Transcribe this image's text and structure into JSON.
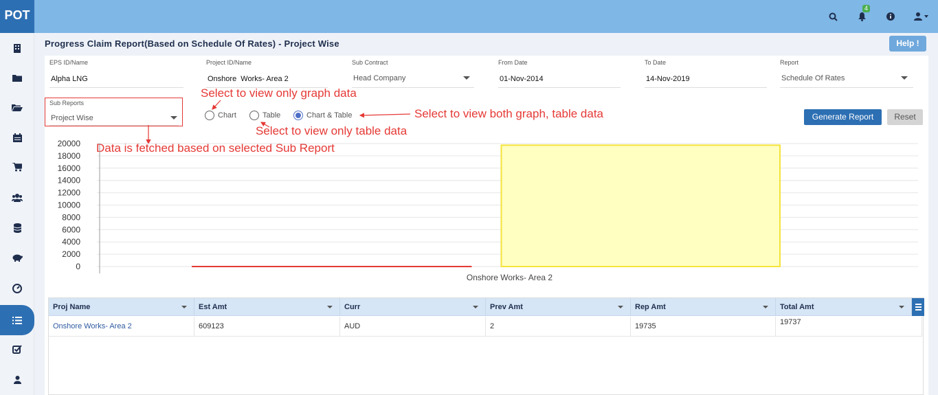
{
  "app": {
    "logo": "POT"
  },
  "topbar": {
    "notification_count": "4",
    "icons": [
      "search-icon",
      "bell-icon",
      "info-icon",
      "user-icon"
    ]
  },
  "sidebar": {
    "items": [
      "building-icon",
      "folder-icon",
      "folder-open-icon",
      "calendar-icon",
      "cart-icon",
      "users-icon",
      "database-icon",
      "piggy-bank-icon",
      "gauge-icon",
      "list-icon",
      "checkbox-icon",
      "person-icon"
    ],
    "active_index": 9
  },
  "page": {
    "title": "Progress Claim Report(Based on Schedule Of Rates) - Project Wise",
    "help_label": "Help !"
  },
  "filters": {
    "eps": {
      "label": "EPS ID/Name",
      "value": "Alpha LNG"
    },
    "project": {
      "label": "Project ID/Name",
      "value": "Onshore  Works- Area 2"
    },
    "sub_contract": {
      "label": "Sub Contract",
      "value": "Head Company"
    },
    "from_date": {
      "label": "From Date",
      "value": "01-Nov-2014"
    },
    "to_date": {
      "label": "To Date",
      "value": "14-Nov-2019"
    },
    "report": {
      "label": "Report",
      "value": "Schedule Of Rates"
    },
    "sub_reports": {
      "label": "Sub Reports",
      "value": "Project Wise"
    }
  },
  "view_options": {
    "chart": "Chart",
    "table": "Table",
    "both": "Chart & Table",
    "selected": "both"
  },
  "buttons": {
    "generate": "Generate Report",
    "reset": "Reset"
  },
  "annotations": {
    "graph": "Select to view only graph data",
    "table": "Select to view only table data",
    "both": "Select to view both graph, table data",
    "sub_report": "Data is fetched based on selected Sub Report"
  },
  "colors": {
    "accent": "#2d6fb3",
    "topbar": "#7fb7e6",
    "annotation": "#e53935",
    "bar_fill": "#ffffc2",
    "bar_stroke": "#f5e33a"
  },
  "chart_data": {
    "type": "bar",
    "categories": [
      "Onshore  Works- Area 2"
    ],
    "series": [
      {
        "values": [
          2
        ]
      },
      {
        "values": [
          19735
        ]
      }
    ],
    "y_ticks": [
      "20000",
      "18000",
      "16000",
      "14000",
      "12000",
      "10000",
      "8000",
      "6000",
      "4000",
      "2000",
      "0"
    ],
    "ylim": [
      0,
      20000
    ],
    "grid": true
  },
  "table": {
    "columns": [
      "Proj Name",
      "Est Amt",
      "Curr",
      "Prev Amt",
      "Rep Amt",
      "Total Amt"
    ],
    "rows": [
      [
        "Onshore Works- Area 2",
        "609123",
        "AUD",
        "2",
        "19735",
        "19737"
      ]
    ]
  }
}
